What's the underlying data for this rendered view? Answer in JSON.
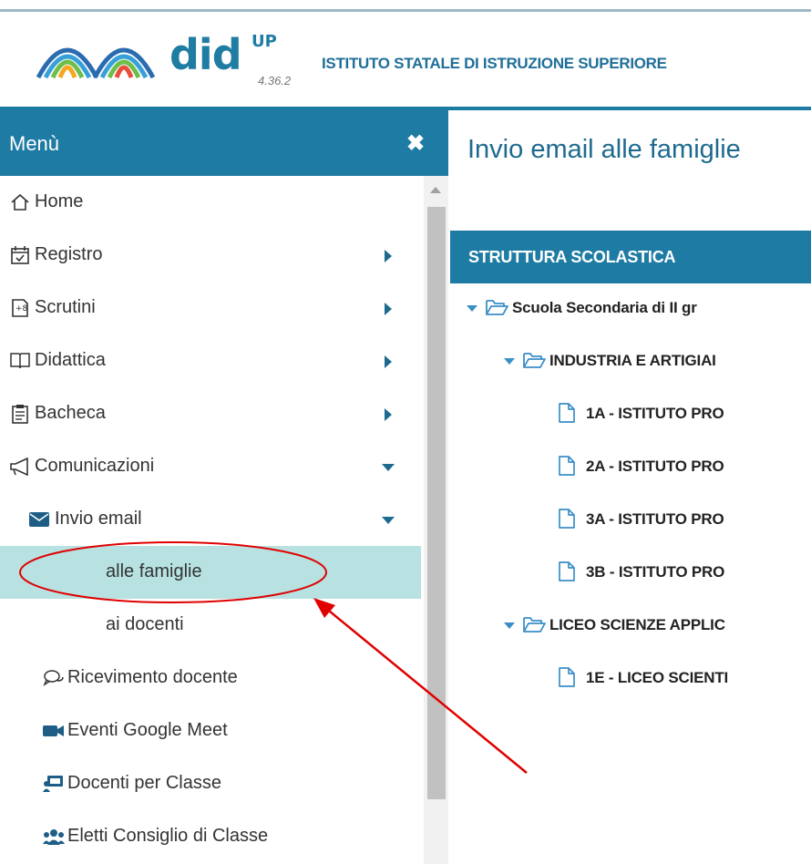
{
  "header": {
    "brand": "did",
    "brand_sup": "UP",
    "version": "4.36.2",
    "institute": "ISTITUTO STATALE DI ISTRUZIONE SUPERIORE"
  },
  "menu": {
    "title": "Menù",
    "close_symbol": "✖",
    "items": [
      {
        "label": "Home",
        "icon": "home-icon"
      },
      {
        "label": "Registro",
        "icon": "calendar-icon"
      },
      {
        "label": "Scrutini",
        "icon": "scrutini-icon"
      },
      {
        "label": "Didattica",
        "icon": "book-icon"
      },
      {
        "label": "Bacheca",
        "icon": "clipboard-icon"
      },
      {
        "label": "Comunicazioni",
        "icon": "megaphone-icon"
      },
      {
        "label": "Invio email",
        "icon": "envelope-icon"
      },
      {
        "label": "alle famiglie",
        "active": true
      },
      {
        "label": "ai docenti"
      },
      {
        "label": "Ricevimento docente",
        "icon": "chat-icon"
      },
      {
        "label": "Eventi Google Meet",
        "icon": "video-icon"
      },
      {
        "label": "Docenti per Classe",
        "icon": "presentation-icon"
      },
      {
        "label": "Eletti Consiglio di Classe",
        "icon": "users-icon"
      }
    ]
  },
  "main": {
    "title": "Invio email alle famiglie",
    "structure_title": "STRUTTURA SCOLASTICA",
    "tree": [
      {
        "label": "Scuola Secondaria di II gr"
      },
      {
        "label": "INDUSTRIA E ARTIGIAI"
      },
      {
        "label": "1A - ISTITUTO PRO"
      },
      {
        "label": "2A - ISTITUTO PRO"
      },
      {
        "label": "3A - ISTITUTO PRO"
      },
      {
        "label": "3B - ISTITUTO PRO"
      },
      {
        "label": "LICEO SCIENZE APPLIC"
      },
      {
        "label": "1E - LICEO SCIENTI"
      }
    ]
  },
  "colors": {
    "accent": "#1e7ba3",
    "active_bg": "#b8e2e2",
    "annotation": "#e00000"
  }
}
